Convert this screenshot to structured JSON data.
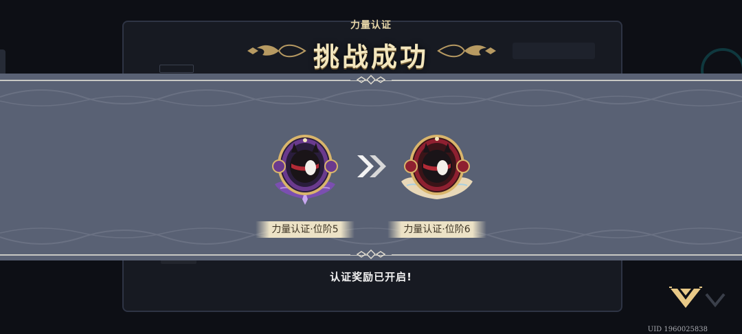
{
  "header": {
    "subtitle": "力量认证",
    "title": "挑战成功"
  },
  "ranks": {
    "from_label": "力量认证·位阶5",
    "to_label": "力量认证·位阶6"
  },
  "reward_message": "认证奖励已开启!",
  "uid": "UID 1960025838",
  "colors": {
    "band": "#596174",
    "gold": "#ecdcae",
    "badge_from_ring": "#6a3a8e",
    "badge_to_ring": "#8e2030"
  },
  "icons": {
    "badge_from": "cat-emblem-purple-icon",
    "badge_to": "cat-emblem-red-icon",
    "progress": "double-chevron-right-icon",
    "confirm": "chevron-down-icon"
  }
}
